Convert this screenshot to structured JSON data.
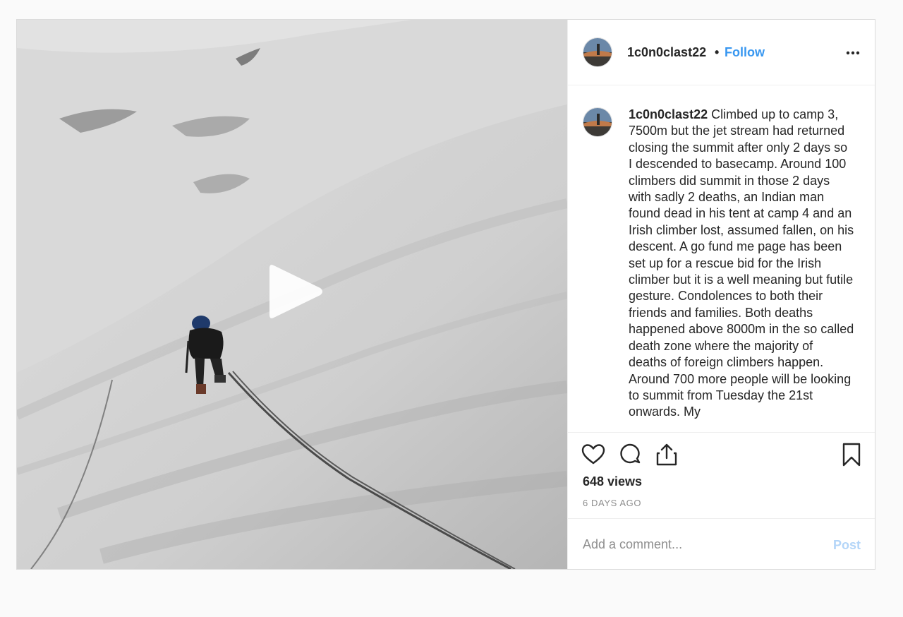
{
  "post": {
    "author": {
      "username": "1c0n0clast22",
      "separator": "•",
      "follow_label": "Follow"
    },
    "media": {
      "type": "video",
      "play_icon": "play-icon"
    },
    "caption": {
      "username": "1c0n0clast22",
      "text": "Climbed up to camp 3, 7500m but the jet stream had returned closing the summit after only 2 days so I descended to basecamp. Around 100 climbers did summit in those 2 days with sadly 2 deaths, an Indian man found dead in his tent at camp 4 and an Irish climber lost, assumed fallen, on his descent. A go fund me page has been set up for a rescue bid for the Irish climber but it is a well meaning but futile gesture. Condolences to both their friends and families. Both deaths happened above 8000m in the so called death zone where the majority of deaths of foreign climbers happen. Around 700 more people will be looking to summit from Tuesday the 21st onwards. My"
    },
    "actions": {
      "icons": [
        "heart-icon",
        "comment-icon",
        "share-icon",
        "bookmark-icon"
      ]
    },
    "views_text": "648 views",
    "date_text": "6 DAYS AGO",
    "comment_form": {
      "placeholder": "Add a comment...",
      "post_label": "Post"
    }
  },
  "colors": {
    "link": "#3897f0",
    "post_disabled": "#b3d5f8",
    "text": "#262626",
    "muted": "#8e8e8e",
    "border": "#dbdbdb"
  }
}
